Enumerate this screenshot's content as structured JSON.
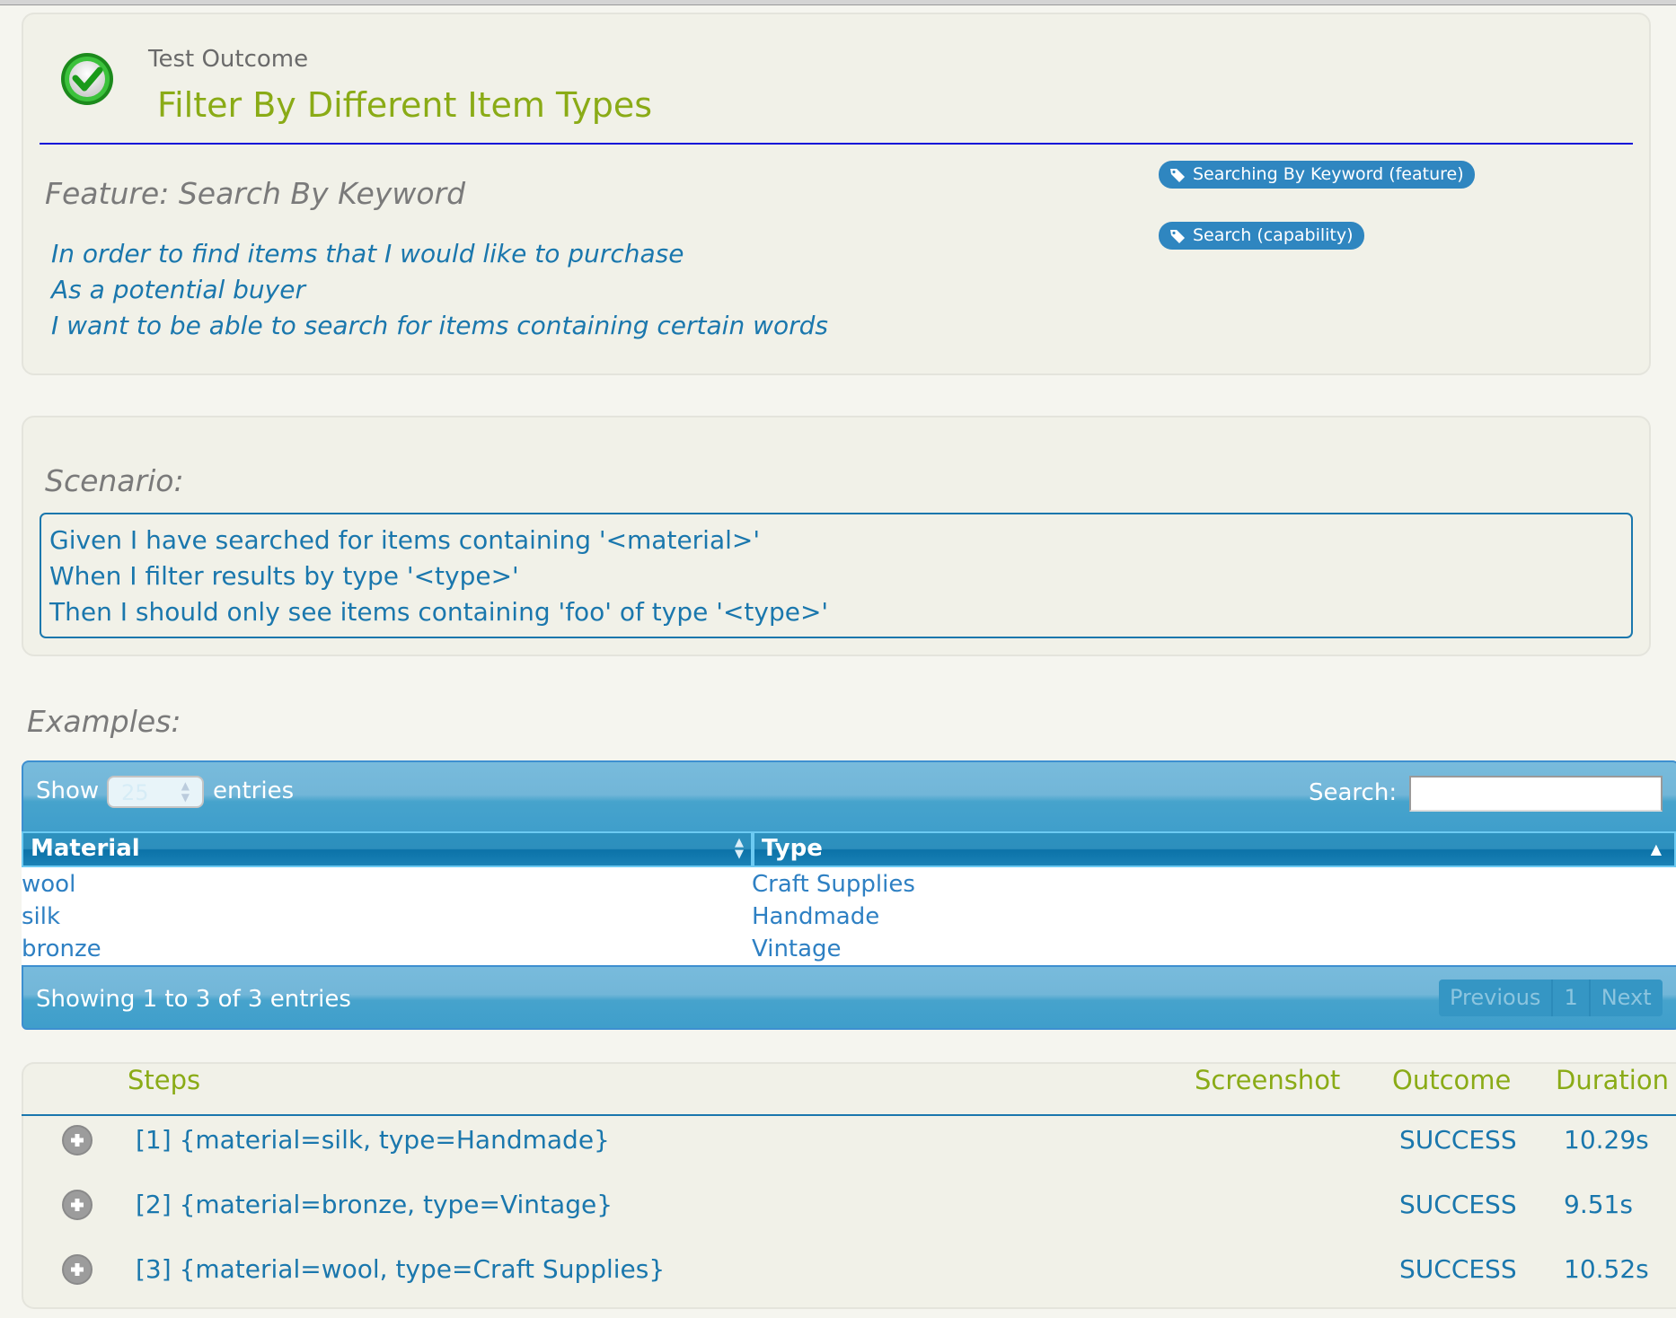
{
  "header": {
    "outcome_label": "Test Outcome",
    "title": "Filter By Different Item Types",
    "status_icon": "success-check-icon"
  },
  "feature": {
    "title": "Feature: Search By Keyword",
    "narrative": [
      "In order to find items that I would like to purchase",
      "As a potential buyer",
      "I want to be able to search for items containing certain words"
    ],
    "tags": [
      {
        "label": "Searching By Keyword (feature)",
        "icon": "tag-icon"
      },
      {
        "label": "Search (capability)",
        "icon": "tag-icon"
      }
    ]
  },
  "scenario": {
    "title": "Scenario:",
    "lines": [
      "Given I have searched for items containing '<material>'",
      "When I filter results by type '<type>'",
      "Then I should only see items containing 'foo' of type '<type>'"
    ]
  },
  "examples": {
    "title": "Examples:",
    "show_label": "Show",
    "page_size": "25",
    "entries_label": "entries",
    "search_label": "Search:",
    "search_value": "",
    "columns": [
      "Material",
      "Type"
    ],
    "rows": [
      [
        "wool",
        "Craft Supplies"
      ],
      [
        "silk",
        "Handmade"
      ],
      [
        "bronze",
        "Vintage"
      ]
    ],
    "info": "Showing 1 to 3 of 3 entries",
    "pager": {
      "previous": "Previous",
      "page": "1",
      "next": "Next"
    }
  },
  "steps": {
    "headers": {
      "steps": "Steps",
      "screenshot": "Screenshot",
      "outcome": "Outcome",
      "duration": "Duration"
    },
    "rows": [
      {
        "label": "[1] {material=silk, type=Handmade}",
        "outcome": "SUCCESS",
        "duration": "10.29s"
      },
      {
        "label": "[2] {material=bronze, type=Vintage}",
        "outcome": "SUCCESS",
        "duration": "9.51s"
      },
      {
        "label": "[3] {material=wool, type=Craft Supplies}",
        "outcome": "SUCCESS",
        "duration": "10.52s"
      }
    ]
  },
  "colors": {
    "title_green": "#8aab16",
    "text_blue": "#1a77ad",
    "tag_blue": "#2f86c0"
  }
}
